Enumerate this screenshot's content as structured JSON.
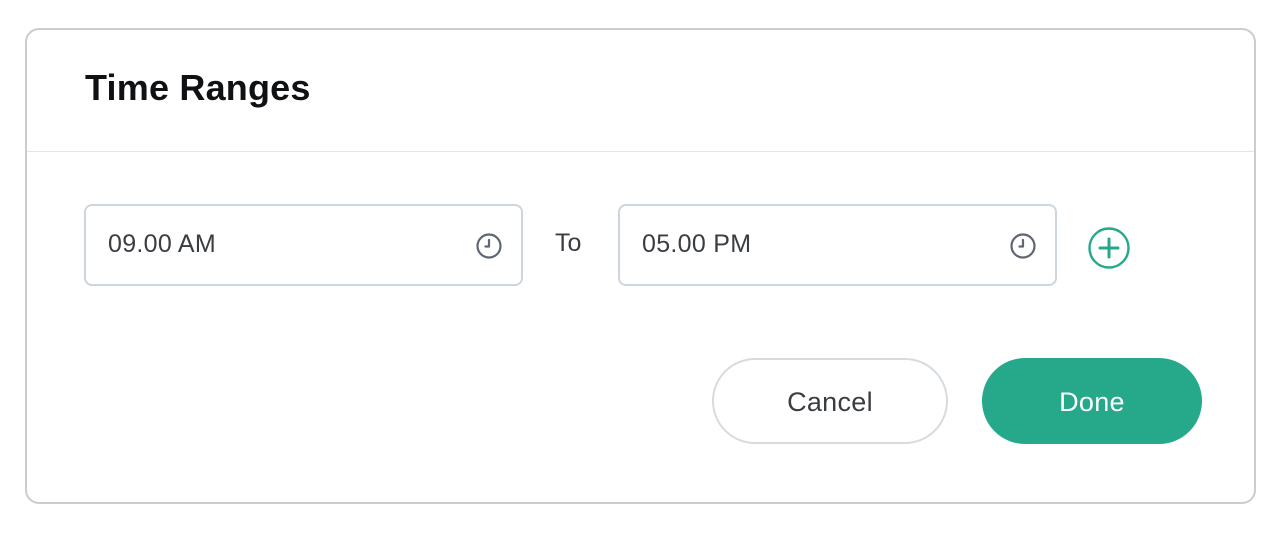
{
  "dialog": {
    "title": "Time Ranges"
  },
  "range": {
    "from_value": "09.00 AM",
    "separator": "To",
    "to_value": "05.00 PM"
  },
  "icons": {
    "from_clock": "clock-icon",
    "to_clock": "clock-icon",
    "add": "plus-circle-icon"
  },
  "actions": {
    "cancel_label": "Cancel",
    "done_label": "Done"
  },
  "colors": {
    "accent": "#25a98a",
    "icon_gray": "#5f6670",
    "border": "#cfd5dc",
    "text": "#3a3d42",
    "title": "#0f1114"
  }
}
